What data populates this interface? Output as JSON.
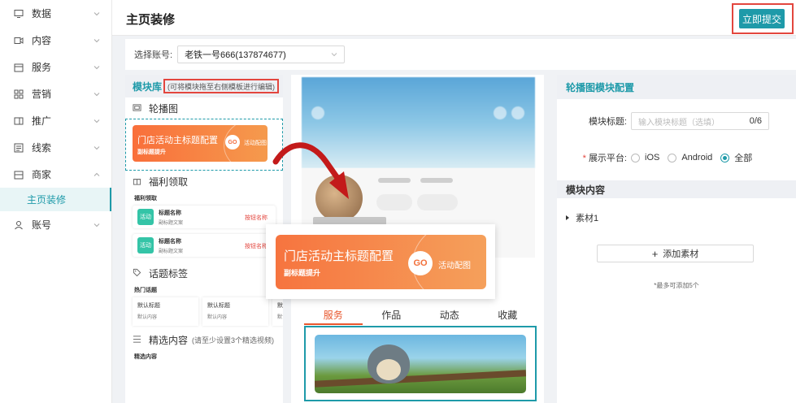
{
  "sidebar": {
    "items": [
      {
        "label": "数据",
        "icon": "monitor-icon"
      },
      {
        "label": "内容",
        "icon": "video-icon"
      },
      {
        "label": "服务",
        "icon": "calendar-icon"
      },
      {
        "label": "营销",
        "icon": "grid-icon"
      },
      {
        "label": "推广",
        "icon": "promo-icon"
      },
      {
        "label": "线索",
        "icon": "list-icon"
      },
      {
        "label": "商家",
        "icon": "store-icon"
      }
    ],
    "active_sub": "主页装修",
    "last_item": {
      "label": "账号",
      "icon": "user-icon"
    }
  },
  "header": {
    "title": "主页装修",
    "submit_label": "立即提交"
  },
  "account": {
    "label": "选择账号:",
    "selected": "老铁一号666(137874677)"
  },
  "library": {
    "title": "模块库",
    "hint": "(可将模块拖至右侧模板进行编辑)",
    "carousel": {
      "label": "轮播图",
      "banner_title": "门店活动主标题配置",
      "banner_sub": "副标题提升",
      "go": "GO",
      "action": "活动配图"
    },
    "benefit": {
      "label": "福利领取",
      "card_label": "福利领取",
      "items": [
        {
          "icon_text": "活动",
          "title": "标题名称",
          "sub": "副标题文案",
          "btn": "按钮名称"
        },
        {
          "icon_text": "活动",
          "title": "标题名称",
          "sub": "副标题文案",
          "btn": "按钮名称"
        }
      ]
    },
    "topic": {
      "label": "话题标签",
      "card_label": "热门话题",
      "items": [
        {
          "title": "默认标题",
          "sub": "默认内容"
        },
        {
          "title": "默认标题",
          "sub": "默认内容"
        },
        {
          "title": "默认",
          "sub": "默认"
        }
      ]
    },
    "featured": {
      "label": "精选内容",
      "note": "(请至少设置3个精选视频)",
      "card_label": "精选内容"
    }
  },
  "preview": {
    "banner_title": "门店活动主标题配置",
    "banner_sub": "副标题提升",
    "go": "GO",
    "action": "活动配图",
    "tabs": [
      "服务",
      "作品",
      "动态",
      "收藏"
    ],
    "active_tab": 0
  },
  "config": {
    "title": "轮播图模块配置",
    "module_title_label": "模块标题:",
    "module_title_placeholder": "输入模块标题（选填）",
    "module_title_count": "0/6",
    "platform_label": "展示平台:",
    "platforms": [
      "iOS",
      "Android",
      "全部"
    ],
    "platform_selected": 2,
    "content_label": "模块内容",
    "material": "素材1",
    "add_label": "添加素材",
    "max_hint": "*最多可添加5个"
  },
  "colors": {
    "accent": "#1e9aa9",
    "highlight": "#e3463e",
    "banner": "#f6743f",
    "tab_active": "#e8572d"
  }
}
